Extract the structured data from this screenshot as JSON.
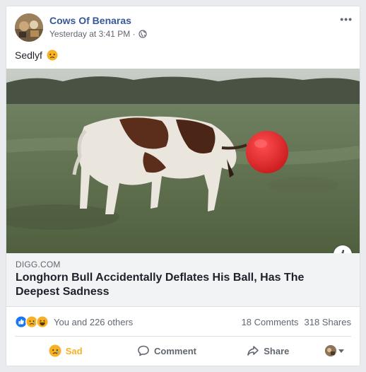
{
  "post": {
    "page_name": "Cows Of Benaras",
    "timestamp": "Yesterday at 3:41 PM ·",
    "status_text": "Sedlyf",
    "more_label": "•••"
  },
  "link_preview": {
    "domain": "DIGG.COM",
    "title": "Longhorn Bull Accidentally Deflates His Ball, Has The Deepest Sadness",
    "info_label": "i"
  },
  "reactions": {
    "summary": "You and 226 others",
    "comments": "18 Comments",
    "shares": "318 Shares"
  },
  "actions": {
    "sad_label": "Sad",
    "comment_label": "Comment",
    "share_label": "Share"
  },
  "colors": {
    "link_blue": "#365899",
    "sad_yellow": "#f7b125",
    "like_blue": "#1877f2",
    "ball_red": "#e8282b"
  }
}
